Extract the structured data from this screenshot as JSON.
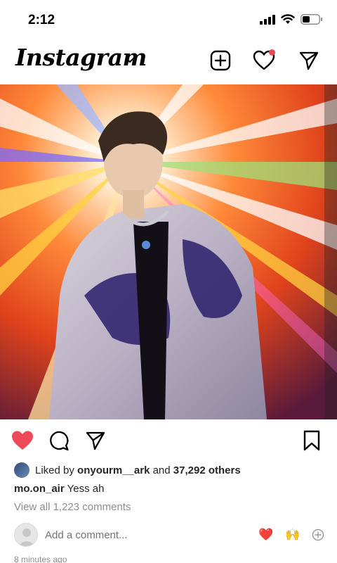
{
  "status_bar": {
    "time": "2:12"
  },
  "header": {
    "brand": "Instagram"
  },
  "post": {
    "liked_by_prefix": "Liked by",
    "liked_by_user": "onyourm__ark",
    "liked_by_joiner": "and",
    "liked_by_others": "37,292 others",
    "caption_user": "mo.on_air",
    "caption_text": "Yess ah",
    "view_comments": "View all 1,223 comments",
    "comment_placeholder": "Add a comment...",
    "quick_reactions": [
      "❤️",
      "🙌"
    ],
    "timestamp": "8 minutes ago"
  },
  "colors": {
    "like_red": "#ed4956",
    "text": "#262626",
    "muted": "#8e8e8e"
  },
  "icons": [
    "signal-icon",
    "wifi-icon",
    "battery-icon",
    "chevron-down-icon",
    "new-post-icon",
    "activity-heart-icon",
    "direct-message-icon",
    "like-heart-icon",
    "comment-icon",
    "share-icon",
    "save-bookmark-icon",
    "add-emoji-icon"
  ]
}
